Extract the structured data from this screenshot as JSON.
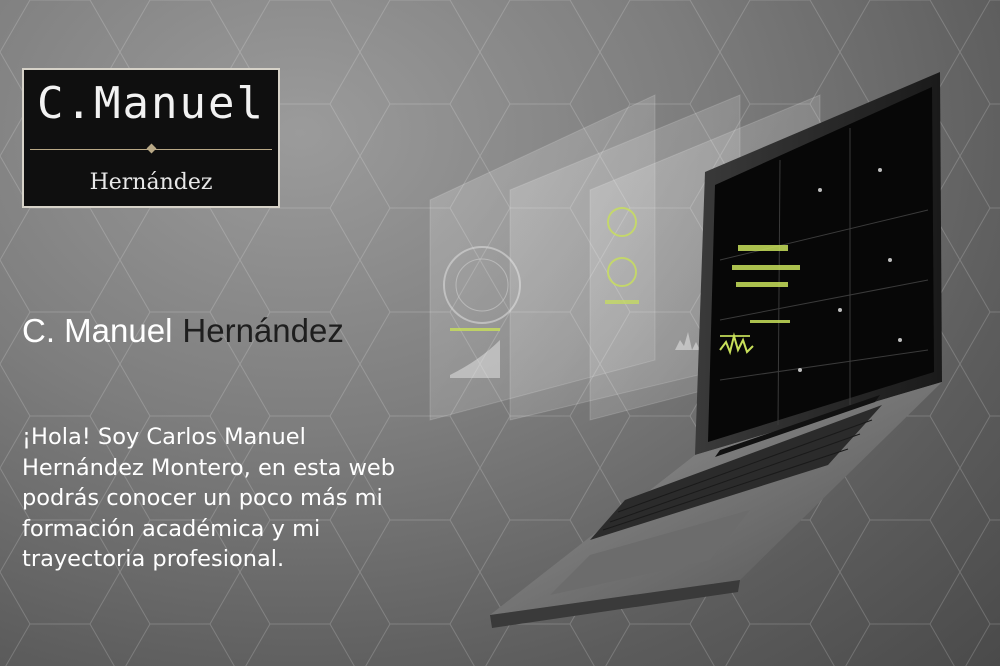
{
  "logo": {
    "top": "C.Manuel",
    "bottom": "Hernández"
  },
  "headline": {
    "first_part": "C. Manuel",
    "last_part": "Hernández"
  },
  "intro": {
    "text": "¡Hola! Soy Carlos Manuel Hernández Montero, en esta web podrás conocer un poco más mi formación académica y mi trayectoria profesional."
  },
  "colors": {
    "background": "#7d7d7d",
    "logo_bg": "#0f0f0f",
    "logo_accent": "#b8a886",
    "screen_accent": "#c8e05a"
  },
  "icons": [
    "laptop-illustration",
    "hud-panel"
  ]
}
